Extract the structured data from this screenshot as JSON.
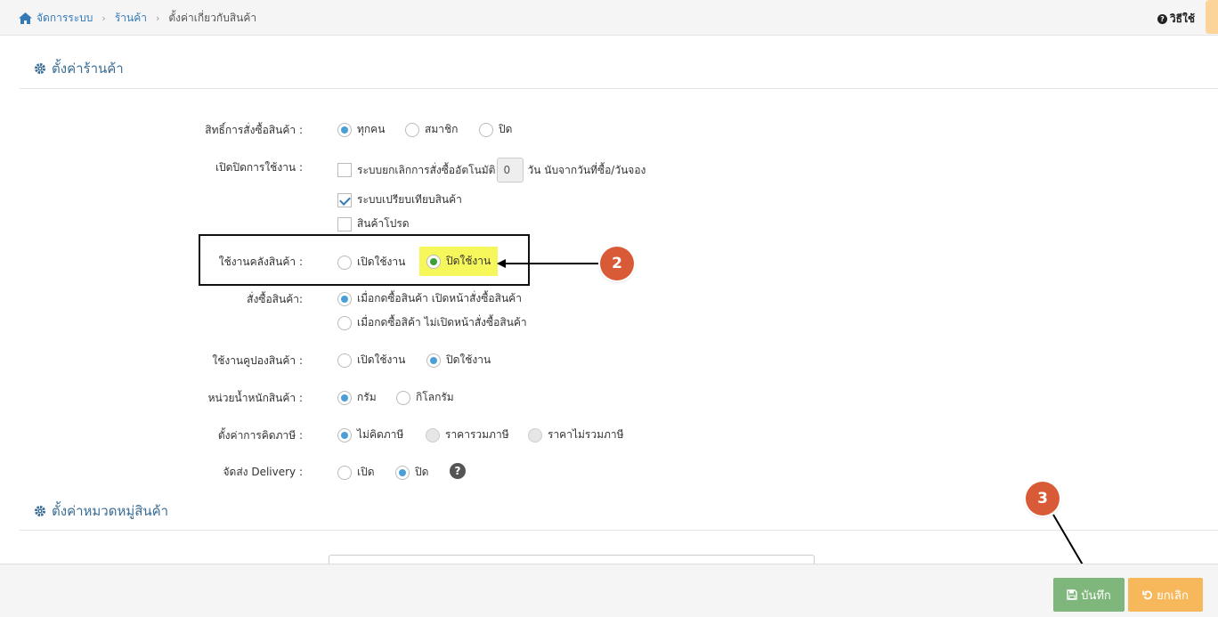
{
  "breadcrumb": {
    "items": [
      "จัดการระบบ",
      "ร้านค้า",
      "ตั้งค่าเกี่ยวกับสินค้า"
    ]
  },
  "header": {
    "help_label": "วิธีใช้"
  },
  "sections": {
    "shop_settings": "ตั้งค่าร้านค้า",
    "category_settings": "ตั้งค่าหมวดหมู่สินค้า"
  },
  "form": {
    "order_rights": {
      "label": "สิทธิ์การสั่งซื้อสินค้า :",
      "options": [
        "ทุกคน",
        "สมาชิก",
        "ปิด"
      ],
      "selected": "ทุกคน"
    },
    "features": {
      "label": "เปิดปิดการใช้งาน :",
      "auto_cancel": {
        "label_before": "ระบบยกเลิกการสั่งซื้ออัตโนมัติ",
        "value": "0",
        "label_after": "วัน นับจากวันที่ซื้อ/วันจอง",
        "checked": false
      },
      "compare": {
        "label": "ระบบเปรียบเทียบสินค้า",
        "checked": true
      },
      "favorite": {
        "label": "สินค้าโปรด",
        "checked": false
      }
    },
    "warehouse": {
      "label": "ใช้งานคลังสินค้า :",
      "options": [
        "เปิดใช้งาน",
        "ปิดใช้งาน"
      ],
      "selected": "ปิดใช้งาน"
    },
    "order_action": {
      "label": "สั่งซื้อสินค้า:",
      "options": [
        "เมื่อกดซื้อสินค้า เปิดหน้าสั่งซื้อสินค้า",
        "เมื่อกดซื้อสิค้า ไม่เปิดหน้าสั่งซื้อสินค้า"
      ],
      "selected": "เมื่อกดซื้อสินค้า เปิดหน้าสั่งซื้อสินค้า"
    },
    "coupon": {
      "label": "ใช้งานคูปองสินค้า :",
      "options": [
        "เปิดใช้งาน",
        "ปิดใช้งาน"
      ],
      "selected": "ปิดใช้งาน"
    },
    "weight_unit": {
      "label": "หน่วยน้ำหนักสินค้า :",
      "options": [
        "กรัม",
        "กิโลกรัม"
      ],
      "selected": "กรัม"
    },
    "tax": {
      "label": "ตั้งค่าการคิดภาษี :",
      "options": [
        "ไม่คิดภาษี",
        "ราคารวมภาษี",
        "ราคาไม่รวมภาษี"
      ],
      "selected": "ไม่คิดภาษี"
    },
    "delivery": {
      "label": "จัดส่ง Delivery :",
      "options": [
        "เปิด",
        "ปิด"
      ],
      "selected": "ปิด"
    }
  },
  "annotations": {
    "step2": "2",
    "step3": "3"
  },
  "footer": {
    "save_label": "บันทึก",
    "cancel_label": "ยกเลิก"
  },
  "colors": {
    "accent": "#337ab7",
    "save": "#7fb67c",
    "cancel": "#f6b85a",
    "badge": "#d85a37",
    "highlight": "#f6f75a"
  }
}
